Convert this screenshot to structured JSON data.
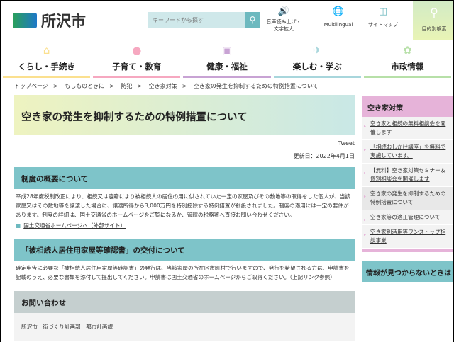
{
  "header": {
    "site_name": "所沢市",
    "search_placeholder": "キーワードから探す",
    "tools": [
      {
        "icon": "speaker-icon",
        "label1": "音声読み上げ・",
        "label2": "文字拡大"
      },
      {
        "icon": "translate-icon",
        "label1": "Multilingual"
      },
      {
        "icon": "sitemap-icon",
        "label1": "サイトマップ"
      }
    ],
    "purpose_search": "目的別検索"
  },
  "nav": [
    {
      "label": "くらし・手続き",
      "color": "#fbe08f",
      "icon": "house-icon"
    },
    {
      "label": "子育て・教育",
      "color": "#f6a8c0",
      "icon": "baby-icon"
    },
    {
      "label": "健康・福祉",
      "color": "#c8a3d4",
      "icon": "medical-icon"
    },
    {
      "label": "楽しむ・学ぶ",
      "color": "#a8d6dc",
      "icon": "airplane-icon"
    },
    {
      "label": "市政情報",
      "color": "#b7e0a8",
      "icon": "city-emblem-icon"
    }
  ],
  "breadcrumb": [
    "トップページ",
    "もしものときに",
    "防犯",
    "空き家対策",
    "空き家の発生を抑制するための特例措置について"
  ],
  "main": {
    "title": "空き家の発生を抑制するための特例措置について",
    "tweet": "Tweet",
    "updated": "更新日：2022年4月1日",
    "section1": {
      "heading": "制度の概要について",
      "body": "平成28年度税制改正により、相続又は遺贈により被相続人の居住の用に供されていた一定の家屋及びその敷地等の取得をした個人が、当該家屋又はその敷地等を譲渡した場合に、譲渡所得から3,000万円を特別控除する特例措置が創設されました。制度の適用には一定の要件があります。制度の詳細は、国土交通省のホームページをご覧になるか、管轄の税務署へ直接お問い合わせください。",
      "link": "国土交通省ホームページへ（外部サイト）"
    },
    "section2": {
      "heading": "「被相続人居住用家屋等確認書」の交付について",
      "body": "確定申告に必要な「被相続人居住用家屋等確認書」の発行は、当該家屋の所在区市町村で行いますので、発行を希望される方は、申請書を記載のうえ、必要な書類を添付して提出してください。申請書は国土交通省のホームページからご取得ください。（上記リンク参照）"
    },
    "contact": {
      "heading": "お問い合わせ",
      "body": "所沢市　街づくり計画部　都市計画課"
    }
  },
  "sidebar": {
    "heading": "空き家対策",
    "items": [
      {
        "l1": "空き家と相続の無料相談会を開",
        "l2": "催します"
      },
      {
        "l1": "「相続おしかけ講座」を無料で",
        "l2": "実施しています。"
      },
      {
        "l1": "【無料】空き家対策セミナー＆",
        "l2": "個別相談会を開催します"
      },
      {
        "l1": "空き家の発生を抑制するための",
        "l2": "特例措置について"
      },
      {
        "l1": "空き家等の適正管理について",
        "l2": ""
      },
      {
        "l1": "空き家利活用等ワンストップ相",
        "l2": "談事業"
      }
    ],
    "heading2": "情報が見つからないときは"
  }
}
